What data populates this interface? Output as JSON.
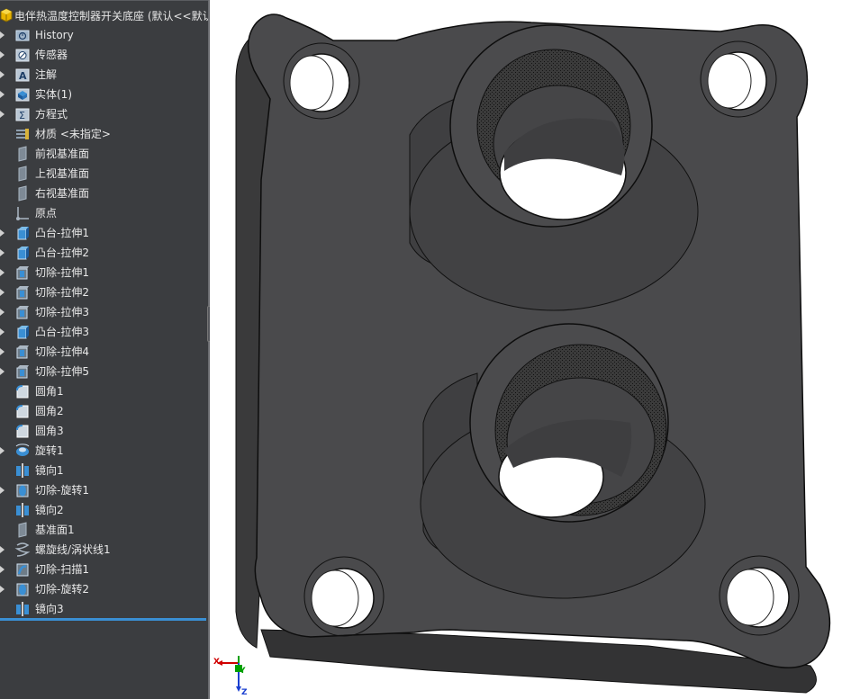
{
  "tree": {
    "root_label": "电伴热温度控制器开关底座 (默认<<默认>",
    "items": [
      {
        "label": "History",
        "icon": "history-folder-icon",
        "expandable": true
      },
      {
        "label": "传感器",
        "icon": "sensors-icon",
        "expandable": true
      },
      {
        "label": "注解",
        "icon": "annotations-icon",
        "expandable": true
      },
      {
        "label": "实体(1)",
        "icon": "solid-bodies-icon",
        "expandable": true
      },
      {
        "label": "方程式",
        "icon": "equations-icon",
        "expandable": true
      },
      {
        "label": "材质 <未指定>",
        "icon": "material-icon",
        "expandable": false
      },
      {
        "label": "前视基准面",
        "icon": "plane-icon",
        "expandable": false
      },
      {
        "label": "上视基准面",
        "icon": "plane-icon",
        "expandable": false
      },
      {
        "label": "右视基准面",
        "icon": "plane-icon",
        "expandable": false
      },
      {
        "label": "原点",
        "icon": "origin-icon",
        "expandable": false
      },
      {
        "label": "凸台-拉伸1",
        "icon": "boss-extrude-icon",
        "expandable": true
      },
      {
        "label": "凸台-拉伸2",
        "icon": "boss-extrude-icon",
        "expandable": true
      },
      {
        "label": "切除-拉伸1",
        "icon": "cut-extrude-icon",
        "expandable": true
      },
      {
        "label": "切除-拉伸2",
        "icon": "cut-extrude-icon",
        "expandable": true
      },
      {
        "label": "切除-拉伸3",
        "icon": "cut-extrude-icon",
        "expandable": true
      },
      {
        "label": "凸台-拉伸3",
        "icon": "boss-extrude-icon",
        "expandable": true
      },
      {
        "label": "切除-拉伸4",
        "icon": "cut-extrude-icon",
        "expandable": true
      },
      {
        "label": "切除-拉伸5",
        "icon": "cut-extrude-icon",
        "expandable": true
      },
      {
        "label": "圆角1",
        "icon": "fillet-icon",
        "expandable": false
      },
      {
        "label": "圆角2",
        "icon": "fillet-icon",
        "expandable": false
      },
      {
        "label": "圆角3",
        "icon": "fillet-icon",
        "expandable": false
      },
      {
        "label": "旋转1",
        "icon": "revolve-icon",
        "expandable": true
      },
      {
        "label": "镜向1",
        "icon": "mirror-icon",
        "expandable": false
      },
      {
        "label": "切除-旋转1",
        "icon": "cut-revolve-icon",
        "expandable": true
      },
      {
        "label": "镜向2",
        "icon": "mirror-icon",
        "expandable": false
      },
      {
        "label": "基准面1",
        "icon": "plane-icon",
        "expandable": false
      },
      {
        "label": "螺旋线/涡状线1",
        "icon": "helix-icon",
        "expandable": true
      },
      {
        "label": "切除-扫描1",
        "icon": "cut-sweep-icon",
        "expandable": true
      },
      {
        "label": "切除-旋转2",
        "icon": "cut-revolve-icon",
        "expandable": true
      },
      {
        "label": "镜向3",
        "icon": "mirror-icon",
        "expandable": false
      }
    ]
  },
  "triad": {
    "x_label": "X",
    "y_label": "Y",
    "z_label": "Z"
  },
  "colors": {
    "panel_bg": "#3b3d40",
    "text": "#e8e8e8",
    "rollback_bar": "#3a8fd4",
    "part_body": "#4a4a4c",
    "part_edge": "#111111"
  }
}
